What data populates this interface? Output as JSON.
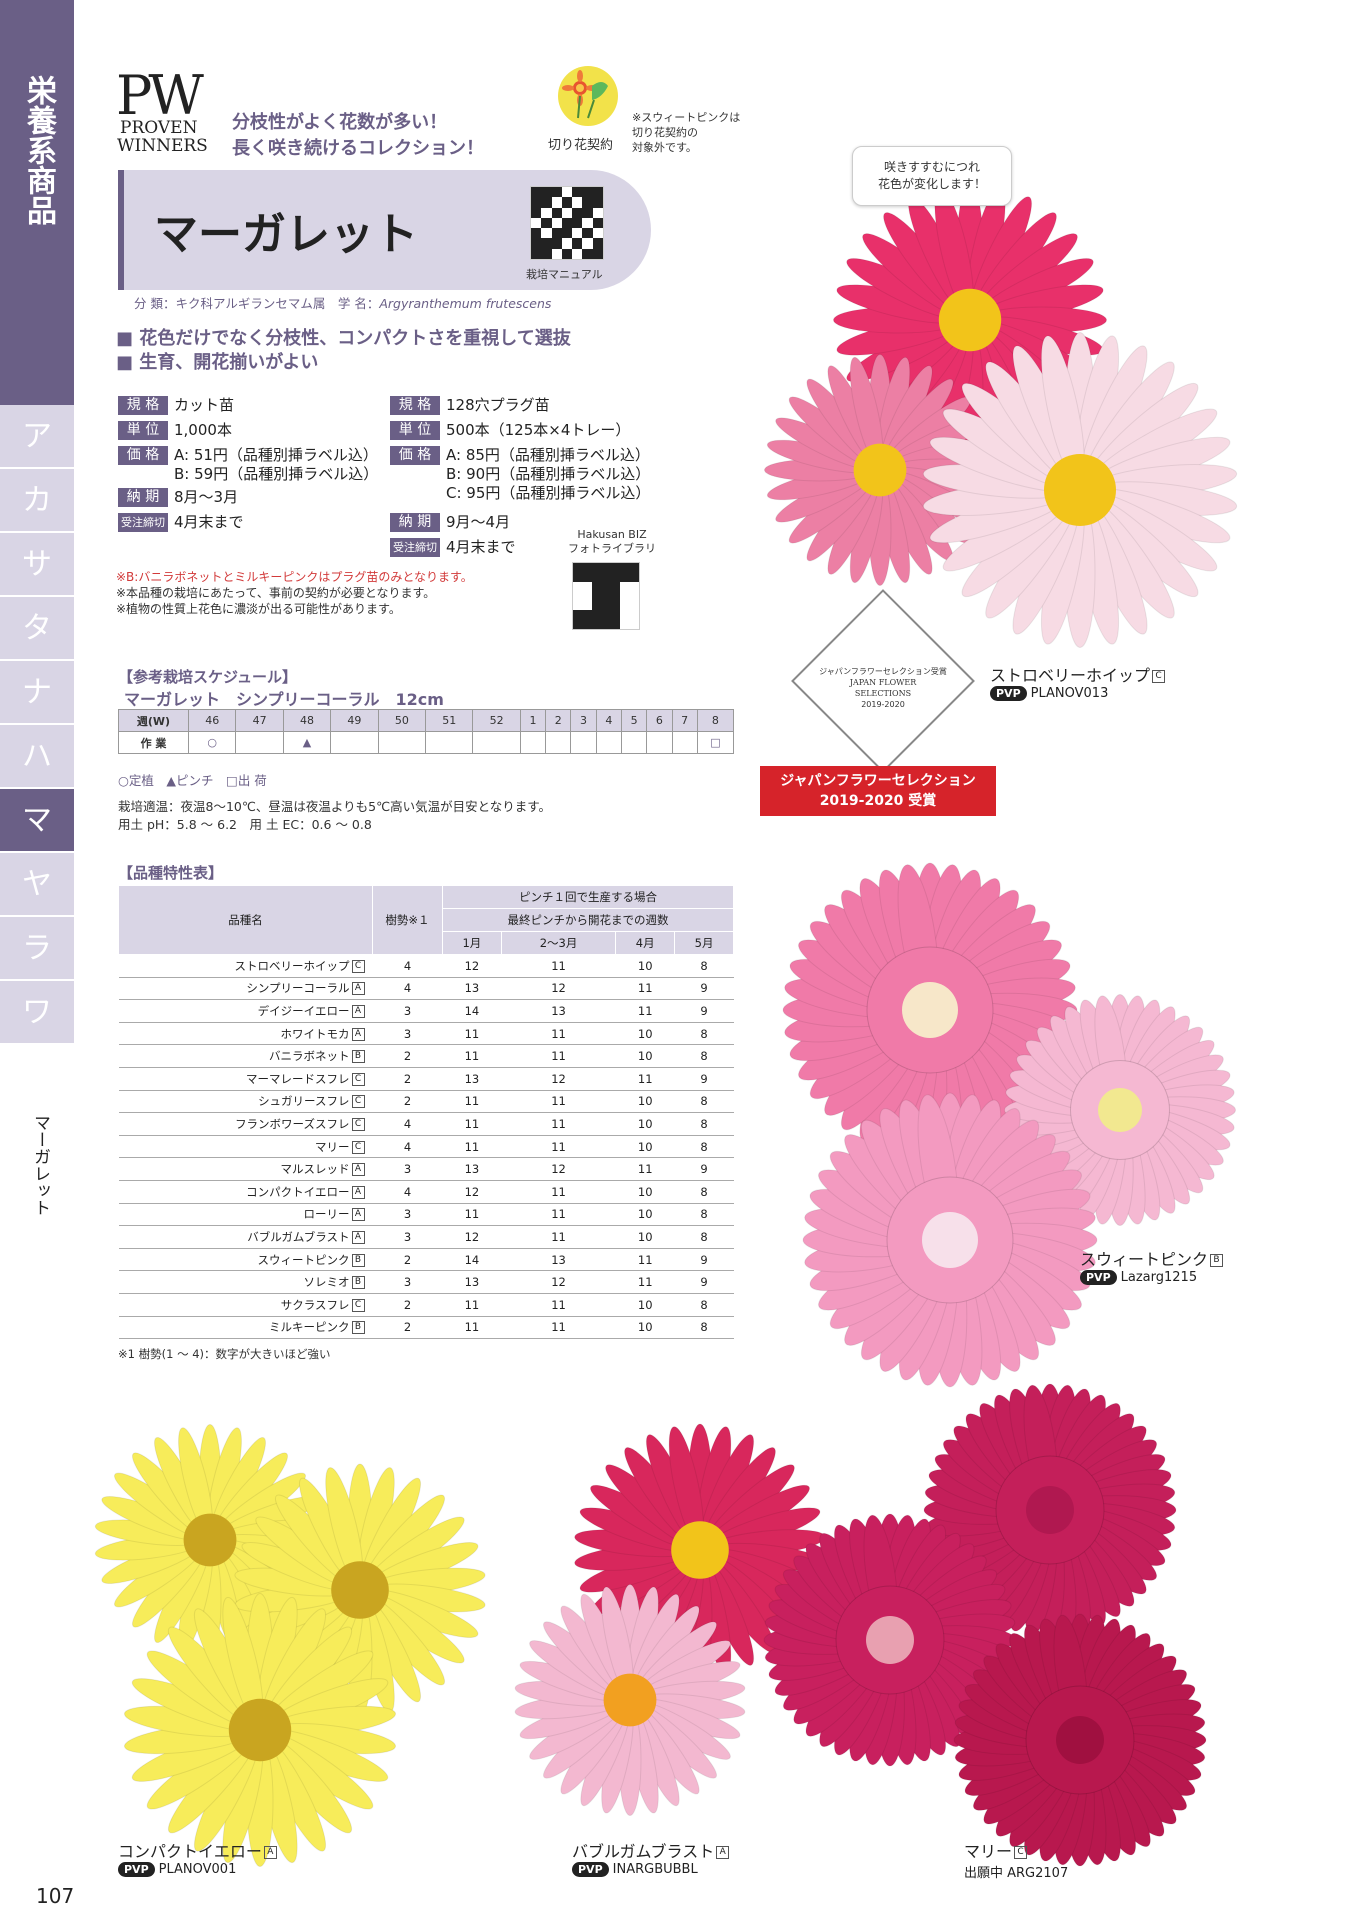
{
  "sidebar": {
    "category": "栄養系商品",
    "kana_tabs": [
      "ア",
      "カ",
      "サ",
      "タ",
      "ナ",
      "ハ",
      "マ",
      "ヤ",
      "ラ",
      "ワ"
    ],
    "active_tab": "マ",
    "current_item": "マーガレット"
  },
  "header": {
    "logo_mark": "PW",
    "logo_line1": "PROVEN",
    "logo_line2": "WINNERS",
    "tagline1": "分枝性がよく花数が多い！",
    "tagline2": "長く咲き続けるコレクション！",
    "cutflower_label": "切り花契約",
    "cutflower_note": "※スウィートピンクは\n切り花契約の\n対象外です。"
  },
  "title": {
    "name": "マーガレット",
    "qr_label": "栽培マニュアル",
    "classification": "分 類：キク科アルギランセマム属　学 名：",
    "scientific_name": "Argyranthemum frutescens"
  },
  "features": [
    "■ 花色だけでなく分枝性、コンパクトさを重視して選抜",
    "■ 生育、開花揃いがよい"
  ],
  "spec_left": [
    {
      "label": "規 格",
      "value": "カット苗"
    },
    {
      "label": "単 位",
      "value": "1,000本"
    },
    {
      "label": "価 格",
      "value": "A: 51円（品種別挿ラベル込）\nB: 59円（品種別挿ラベル込）"
    },
    {
      "label": "納 期",
      "value": "8月〜3月"
    },
    {
      "label": "受注締切",
      "value": "4月末まで"
    }
  ],
  "spec_right": [
    {
      "label": "規 格",
      "value": "128穴プラグ苗"
    },
    {
      "label": "単 位",
      "value": "500本（125本×4トレー）"
    },
    {
      "label": "価 格",
      "value": "A: 85円（品種別挿ラベル込）\nB: 90円（品種別挿ラベル込）\nC: 95円（品種別挿ラベル込）"
    },
    {
      "label": "納 期",
      "value": "9月〜4月"
    },
    {
      "label": "受注締切",
      "value": "4月末まで"
    }
  ],
  "hakusan": {
    "line1": "Hakusan BIZ",
    "line2": "フォトライブラリ"
  },
  "notes": {
    "red": "※B:バニラボネットとミルキーピンクはプラグ苗のみとなります。",
    "n1": "※本品種の栽培にあたって、事前の契約が必要となります。",
    "n2": "※植物の性質上花色に濃淡が出る可能性があります。"
  },
  "schedule": {
    "title": "【参考栽培スケジュール】",
    "subtitle": "マーガレット　シンプリーコーラル　12cm",
    "week_label": "週(W)",
    "weeks": [
      "46",
      "47",
      "48",
      "49",
      "50",
      "51",
      "52",
      "1",
      "2",
      "3",
      "4",
      "5",
      "6",
      "7",
      "8"
    ],
    "work_label": "作 業",
    "work": [
      "○",
      "",
      "▲",
      "",
      "",
      "",
      "",
      "",
      "",
      "",
      "",
      "",
      "",
      "",
      "□"
    ],
    "legend": "○定植　▲ピンチ　□出 荷",
    "temp": "栽培適温：夜温8〜10℃、昼温は夜温よりも5℃高い気温が目安となります。",
    "soil": "用土 pH：5.8 〜 6.2　用 土 EC：0.6 〜 0.8"
  },
  "variety_table": {
    "title": "【品種特性表】",
    "col_name": "品種名",
    "col_vigor": "樹勢※１",
    "group1": "ピンチ１回で生産する場合",
    "group2": "最終ピンチから開花までの週数",
    "months": [
      "1月",
      "2〜3月",
      "4月",
      "5月"
    ],
    "rows": [
      {
        "name": "ストロベリーホイップ",
        "badge": "C",
        "vigor": "4",
        "m": [
          "12",
          "11",
          "10",
          "8"
        ]
      },
      {
        "name": "シンプリーコーラル",
        "badge": "A",
        "vigor": "4",
        "m": [
          "13",
          "12",
          "11",
          "9"
        ]
      },
      {
        "name": "デイジーイエロー",
        "badge": "A",
        "vigor": "3",
        "m": [
          "14",
          "13",
          "11",
          "9"
        ]
      },
      {
        "name": "ホワイトモカ",
        "badge": "A",
        "vigor": "3",
        "m": [
          "11",
          "11",
          "10",
          "8"
        ]
      },
      {
        "name": "バニラボネット",
        "badge": "B",
        "vigor": "2",
        "m": [
          "11",
          "11",
          "10",
          "8"
        ]
      },
      {
        "name": "マーマレードスフレ",
        "badge": "C",
        "vigor": "2",
        "m": [
          "13",
          "12",
          "11",
          "9"
        ]
      },
      {
        "name": "シュガリースフレ",
        "badge": "C",
        "vigor": "2",
        "m": [
          "11",
          "11",
          "10",
          "8"
        ]
      },
      {
        "name": "フランボワーズスフレ",
        "badge": "C",
        "vigor": "4",
        "m": [
          "11",
          "11",
          "10",
          "8"
        ]
      },
      {
        "name": "マリー",
        "badge": "C",
        "vigor": "4",
        "m": [
          "11",
          "11",
          "10",
          "8"
        ]
      },
      {
        "name": "マルスレッド",
        "badge": "A",
        "vigor": "3",
        "m": [
          "13",
          "12",
          "11",
          "9"
        ]
      },
      {
        "name": "コンパクトイエロー",
        "badge": "A",
        "vigor": "4",
        "m": [
          "12",
          "11",
          "10",
          "8"
        ]
      },
      {
        "name": "ローリー",
        "badge": "A",
        "vigor": "3",
        "m": [
          "11",
          "11",
          "10",
          "8"
        ]
      },
      {
        "name": "バブルガムブラスト",
        "badge": "A",
        "vigor": "3",
        "m": [
          "12",
          "11",
          "10",
          "8"
        ]
      },
      {
        "name": "スウィートピンク",
        "badge": "B",
        "vigor": "2",
        "m": [
          "14",
          "13",
          "11",
          "9"
        ]
      },
      {
        "name": "ソレミオ",
        "badge": "B",
        "vigor": "3",
        "m": [
          "13",
          "12",
          "11",
          "9"
        ]
      },
      {
        "name": "サクラスフレ",
        "badge": "C",
        "vigor": "2",
        "m": [
          "11",
          "11",
          "10",
          "8"
        ]
      },
      {
        "name": "ミルキーピンク",
        "badge": "B",
        "vigor": "2",
        "m": [
          "11",
          "11",
          "10",
          "8"
        ]
      }
    ],
    "footnote": "※1 樹勢(1 〜 4)：数字が大きいほど強い"
  },
  "photos": {
    "speech": "咲きすすむにつれ\n花色が変化します！",
    "award_line1": "ジャパンフラワーセレクション",
    "award_line2": "2019-2020 受賞",
    "award_seal1": "ジャパンフラワーセレクション受賞",
    "award_seal2": "JAPAN FLOWER\nSELECTIONS",
    "award_seal3": "2019-2020",
    "pvp": "PVP",
    "captions": [
      {
        "name": "ストロベリーホイップ",
        "badge": "C",
        "code": "PLANOV013"
      },
      {
        "name": "スウィートピンク",
        "badge": "B",
        "code": "Lazarg1215"
      },
      {
        "name": "コンパクトイエロー",
        "badge": "A",
        "code": "PLANOV001"
      },
      {
        "name": "バブルガムブラスト",
        "badge": "A",
        "code": "INARGBUBBL"
      },
      {
        "name": "マリー",
        "badge": "C",
        "code": "出願中 ARG2107"
      }
    ]
  },
  "page_number": "107",
  "colors": {
    "brand": "#6a5f86",
    "light": "#d9d5e5",
    "award": "#d6232a"
  }
}
